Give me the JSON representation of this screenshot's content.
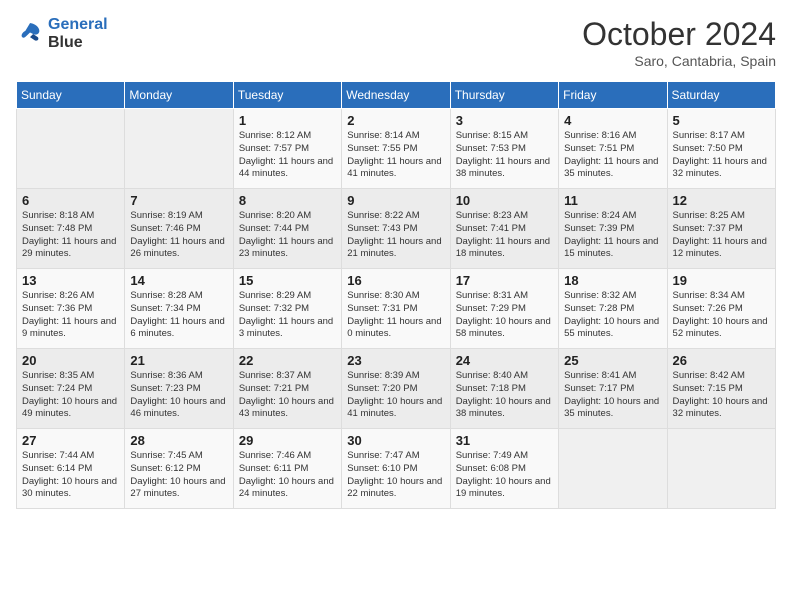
{
  "logo": {
    "line1": "General",
    "line2": "Blue"
  },
  "title": "October 2024",
  "subtitle": "Saro, Cantabria, Spain",
  "days_of_week": [
    "Sunday",
    "Monday",
    "Tuesday",
    "Wednesday",
    "Thursday",
    "Friday",
    "Saturday"
  ],
  "weeks": [
    [
      {
        "day": "",
        "info": ""
      },
      {
        "day": "",
        "info": ""
      },
      {
        "day": "1",
        "info": "Sunrise: 8:12 AM\nSunset: 7:57 PM\nDaylight: 11 hours and 44 minutes."
      },
      {
        "day": "2",
        "info": "Sunrise: 8:14 AM\nSunset: 7:55 PM\nDaylight: 11 hours and 41 minutes."
      },
      {
        "day": "3",
        "info": "Sunrise: 8:15 AM\nSunset: 7:53 PM\nDaylight: 11 hours and 38 minutes."
      },
      {
        "day": "4",
        "info": "Sunrise: 8:16 AM\nSunset: 7:51 PM\nDaylight: 11 hours and 35 minutes."
      },
      {
        "day": "5",
        "info": "Sunrise: 8:17 AM\nSunset: 7:50 PM\nDaylight: 11 hours and 32 minutes."
      }
    ],
    [
      {
        "day": "6",
        "info": "Sunrise: 8:18 AM\nSunset: 7:48 PM\nDaylight: 11 hours and 29 minutes."
      },
      {
        "day": "7",
        "info": "Sunrise: 8:19 AM\nSunset: 7:46 PM\nDaylight: 11 hours and 26 minutes."
      },
      {
        "day": "8",
        "info": "Sunrise: 8:20 AM\nSunset: 7:44 PM\nDaylight: 11 hours and 23 minutes."
      },
      {
        "day": "9",
        "info": "Sunrise: 8:22 AM\nSunset: 7:43 PM\nDaylight: 11 hours and 21 minutes."
      },
      {
        "day": "10",
        "info": "Sunrise: 8:23 AM\nSunset: 7:41 PM\nDaylight: 11 hours and 18 minutes."
      },
      {
        "day": "11",
        "info": "Sunrise: 8:24 AM\nSunset: 7:39 PM\nDaylight: 11 hours and 15 minutes."
      },
      {
        "day": "12",
        "info": "Sunrise: 8:25 AM\nSunset: 7:37 PM\nDaylight: 11 hours and 12 minutes."
      }
    ],
    [
      {
        "day": "13",
        "info": "Sunrise: 8:26 AM\nSunset: 7:36 PM\nDaylight: 11 hours and 9 minutes."
      },
      {
        "day": "14",
        "info": "Sunrise: 8:28 AM\nSunset: 7:34 PM\nDaylight: 11 hours and 6 minutes."
      },
      {
        "day": "15",
        "info": "Sunrise: 8:29 AM\nSunset: 7:32 PM\nDaylight: 11 hours and 3 minutes."
      },
      {
        "day": "16",
        "info": "Sunrise: 8:30 AM\nSunset: 7:31 PM\nDaylight: 11 hours and 0 minutes."
      },
      {
        "day": "17",
        "info": "Sunrise: 8:31 AM\nSunset: 7:29 PM\nDaylight: 10 hours and 58 minutes."
      },
      {
        "day": "18",
        "info": "Sunrise: 8:32 AM\nSunset: 7:28 PM\nDaylight: 10 hours and 55 minutes."
      },
      {
        "day": "19",
        "info": "Sunrise: 8:34 AM\nSunset: 7:26 PM\nDaylight: 10 hours and 52 minutes."
      }
    ],
    [
      {
        "day": "20",
        "info": "Sunrise: 8:35 AM\nSunset: 7:24 PM\nDaylight: 10 hours and 49 minutes."
      },
      {
        "day": "21",
        "info": "Sunrise: 8:36 AM\nSunset: 7:23 PM\nDaylight: 10 hours and 46 minutes."
      },
      {
        "day": "22",
        "info": "Sunrise: 8:37 AM\nSunset: 7:21 PM\nDaylight: 10 hours and 43 minutes."
      },
      {
        "day": "23",
        "info": "Sunrise: 8:39 AM\nSunset: 7:20 PM\nDaylight: 10 hours and 41 minutes."
      },
      {
        "day": "24",
        "info": "Sunrise: 8:40 AM\nSunset: 7:18 PM\nDaylight: 10 hours and 38 minutes."
      },
      {
        "day": "25",
        "info": "Sunrise: 8:41 AM\nSunset: 7:17 PM\nDaylight: 10 hours and 35 minutes."
      },
      {
        "day": "26",
        "info": "Sunrise: 8:42 AM\nSunset: 7:15 PM\nDaylight: 10 hours and 32 minutes."
      }
    ],
    [
      {
        "day": "27",
        "info": "Sunrise: 7:44 AM\nSunset: 6:14 PM\nDaylight: 10 hours and 30 minutes."
      },
      {
        "day": "28",
        "info": "Sunrise: 7:45 AM\nSunset: 6:12 PM\nDaylight: 10 hours and 27 minutes."
      },
      {
        "day": "29",
        "info": "Sunrise: 7:46 AM\nSunset: 6:11 PM\nDaylight: 10 hours and 24 minutes."
      },
      {
        "day": "30",
        "info": "Sunrise: 7:47 AM\nSunset: 6:10 PM\nDaylight: 10 hours and 22 minutes."
      },
      {
        "day": "31",
        "info": "Sunrise: 7:49 AM\nSunset: 6:08 PM\nDaylight: 10 hours and 19 minutes."
      },
      {
        "day": "",
        "info": ""
      },
      {
        "day": "",
        "info": ""
      }
    ]
  ]
}
